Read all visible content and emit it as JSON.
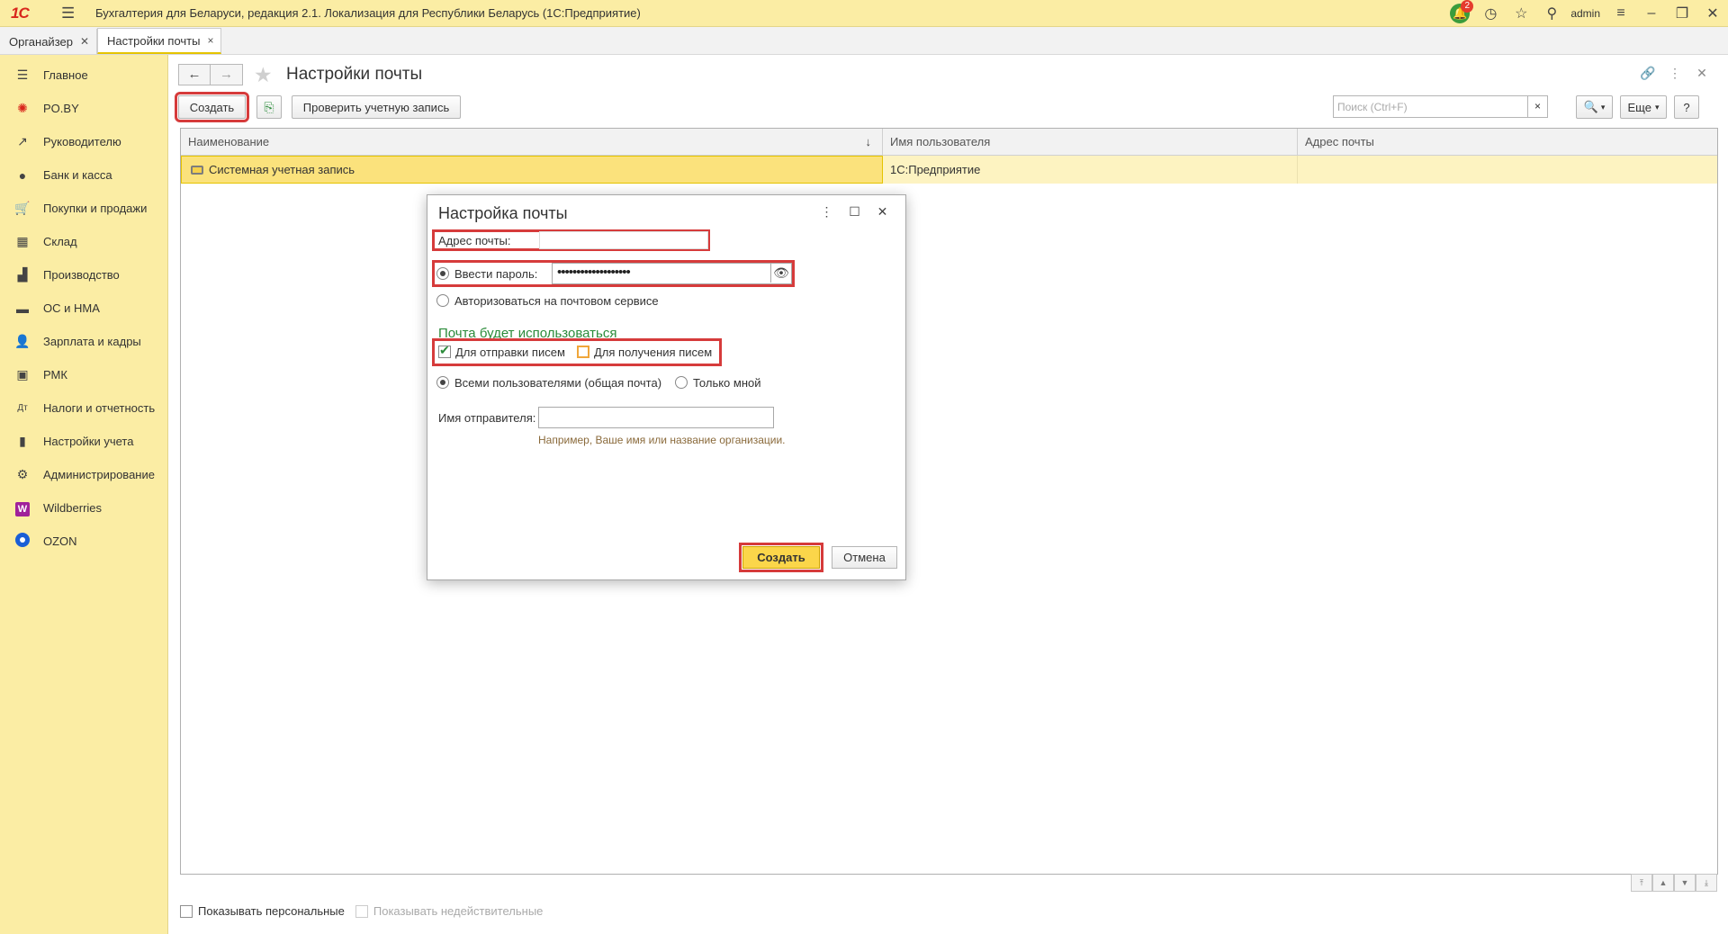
{
  "app": {
    "logo": "1С",
    "title": "Бухгалтерия для Беларуси, редакция 2.1. Локализация для Республики Беларусь  (1С:Предприятие)",
    "notifications_count": "2",
    "user": "admin"
  },
  "tabs": [
    {
      "label": "Органайзер"
    },
    {
      "label": "Настройки почты"
    }
  ],
  "sidebar": {
    "items": [
      {
        "label": "Главное",
        "icon": "hamburger-icon"
      },
      {
        "label": "PO.BY",
        "icon": "pobу-icon"
      },
      {
        "label": "Руководителю",
        "icon": "trend-icon"
      },
      {
        "label": "Банк и касса",
        "icon": "coin-icon"
      },
      {
        "label": "Покупки и продажи",
        "icon": "cart-icon"
      },
      {
        "label": "Склад",
        "icon": "grid-icon"
      },
      {
        "label": "Производство",
        "icon": "factory-icon"
      },
      {
        "label": "ОС и НМА",
        "icon": "truck-icon"
      },
      {
        "label": "Зарплата и кадры",
        "icon": "person-icon"
      },
      {
        "label": "РМК",
        "icon": "cash-register-icon"
      },
      {
        "label": "Налоги и отчетность",
        "icon": "tax-icon"
      },
      {
        "label": "Настройки учета",
        "icon": "book-icon"
      },
      {
        "label": "Администрирование",
        "icon": "gear-icon"
      },
      {
        "label": "Wildberries",
        "icon": "wildberries-icon"
      },
      {
        "label": "OZON",
        "icon": "ozon-icon"
      }
    ]
  },
  "form": {
    "title": "Настройки почты",
    "create_label": "Создать",
    "check_label": "Проверить учетную запись",
    "search_placeholder": "Поиск (Ctrl+F)",
    "search_clear": "×",
    "more_label": "Еще",
    "help_label": "?",
    "columns": [
      "Наименование",
      "Имя пользователя",
      "Адрес почты"
    ],
    "rows": [
      {
        "name": "Системная учетная запись",
        "user": "1С:Предприятие",
        "email": ""
      }
    ],
    "show_personal": "Показывать персональные",
    "show_invalid": "Показывать недействительные"
  },
  "dialog": {
    "title": "Настройка почты",
    "email_label": "Адрес почты:",
    "email_value": "",
    "enter_password_label": "Ввести пароль:",
    "password_mask": "•••••••••••••••••••",
    "auth_service_label": "Авторизоваться на почтовом сервисе",
    "usage_heading": "Почта будет использоваться",
    "send_label": "Для отправки писем",
    "receive_label": "Для получения писем",
    "all_users_label": "Всеми пользователями (общая почта)",
    "only_me_label": "Только мной",
    "sender_label": "Имя отправителя:",
    "sender_value": "",
    "hint": "Например, Ваше имя или название организации.",
    "create_label": "Создать",
    "cancel_label": "Отмена"
  }
}
